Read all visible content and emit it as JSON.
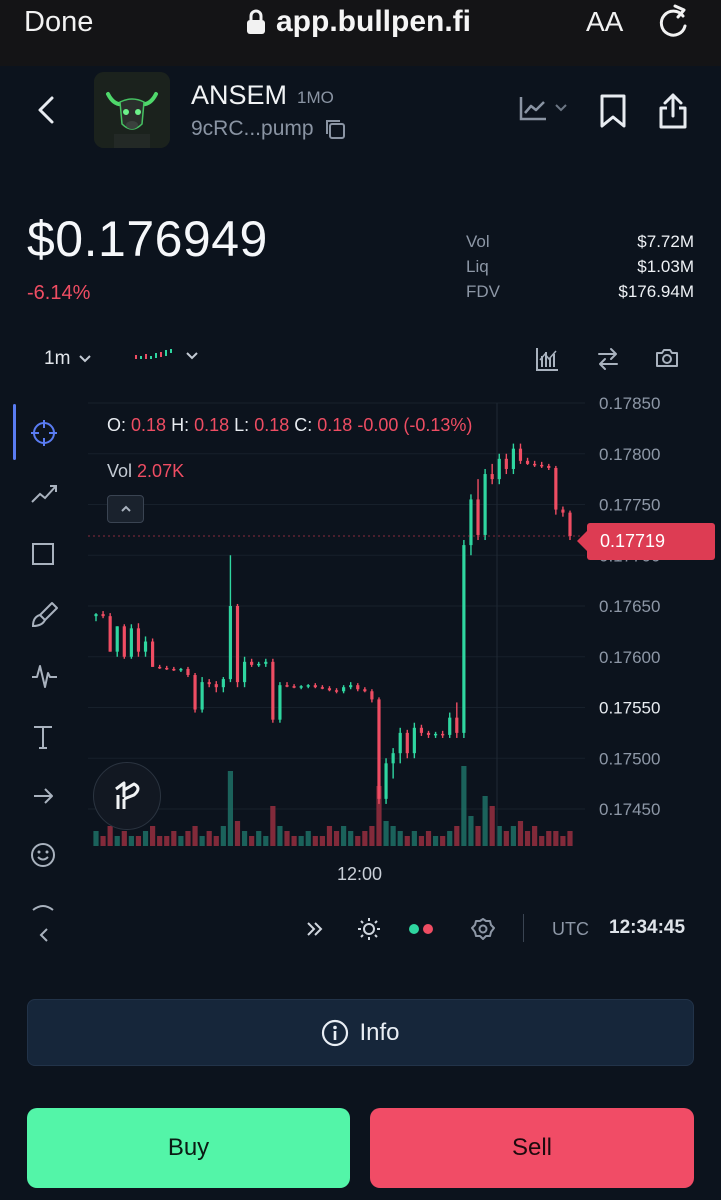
{
  "browser": {
    "done_label": "Done",
    "url": "app.bullpen.fi",
    "text_size_label": "AA",
    "icons": [
      "lock-icon",
      "reload-icon"
    ]
  },
  "token": {
    "name": "ANSEM",
    "age": "1MO",
    "address": "9cRC...pump",
    "price": "$0.176949",
    "change_24h": "-6.14%",
    "stats": [
      {
        "label": "Vol",
        "value": "$7.72M"
      },
      {
        "label": "Liq",
        "value": "$1.03M"
      },
      {
        "label": "FDV",
        "value": "$176.94M"
      }
    ]
  },
  "chart_toolbar": {
    "interval": "1m",
    "icons": [
      "candles-icon",
      "indicators-icon",
      "swap-icon",
      "camera-icon"
    ]
  },
  "drawing_tools": [
    "crosshair-icon",
    "trend-line-icon",
    "rectangle-icon",
    "brush-icon",
    "pattern-icon",
    "text-tool-icon",
    "arrow-icon",
    "emoji-icon"
  ],
  "legend": {
    "o_label": "O:",
    "o": "0.18",
    "h_label": "H:",
    "h": "0.18",
    "l_label": "L:",
    "l": "0.18",
    "c_label": "C:",
    "c": "0.18",
    "chg": "-0.00",
    "chg_pct": "(-0.13%)",
    "vol_label": "Vol",
    "vol": "2.07K"
  },
  "current_price_label": "0.17719",
  "bottom_toolbar": {
    "timezone": "UTC",
    "time": "12:34:45"
  },
  "info_button_label": "Info",
  "buy_label": "Buy",
  "sell_label": "Sell",
  "colors": {
    "up": "#2fd6a0",
    "down": "#ef4d63",
    "accent": "#5a7cf2",
    "buy": "#53f5a8",
    "sell": "#f14c66"
  },
  "chart_data": {
    "type": "candlestick",
    "title": "",
    "xlabel": "",
    "ylabel": "",
    "x_tick_labels": [
      "12:00"
    ],
    "y_ticks": [
      "0.17850",
      "0.17800",
      "0.17750",
      "0.17700",
      "0.17650",
      "0.17600",
      "0.17550",
      "0.17500",
      "0.17450"
    ],
    "ylim": [
      0.1743,
      0.1787
    ],
    "last_price": 0.17719,
    "series": [
      {
        "name": "",
        "candles": [
          [
            0.1764,
            0.17643,
            0.17635,
            0.17642
          ],
          [
            0.17642,
            0.17645,
            0.17638,
            0.1764
          ],
          [
            0.1764,
            0.17643,
            0.17605,
            0.17605
          ],
          [
            0.17605,
            0.1763,
            0.176,
            0.1763
          ],
          [
            0.1763,
            0.17632,
            0.17598,
            0.176
          ],
          [
            0.176,
            0.17632,
            0.17598,
            0.17628
          ],
          [
            0.17628,
            0.17633,
            0.176,
            0.17605
          ],
          [
            0.17605,
            0.1762,
            0.176,
            0.17615
          ],
          [
            0.17615,
            0.17618,
            0.1759,
            0.1759
          ],
          [
            0.1759,
            0.17592,
            0.17588,
            0.17589
          ],
          [
            0.17589,
            0.17591,
            0.17587,
            0.17588
          ],
          [
            0.17588,
            0.1759,
            0.17586,
            0.17587
          ],
          [
            0.17587,
            0.17589,
            0.17585,
            0.17588
          ],
          [
            0.17588,
            0.1759,
            0.1758,
            0.17582
          ],
          [
            0.17582,
            0.17584,
            0.17545,
            0.17548
          ],
          [
            0.17548,
            0.1758,
            0.17545,
            0.17575
          ],
          [
            0.17575,
            0.17578,
            0.1757,
            0.17573
          ],
          [
            0.17573,
            0.17576,
            0.17565,
            0.1757
          ],
          [
            0.1757,
            0.1758,
            0.17565,
            0.17578
          ],
          [
            0.17578,
            0.177,
            0.17575,
            0.1765
          ],
          [
            0.1765,
            0.17652,
            0.1757,
            0.17575
          ],
          [
            0.17575,
            0.176,
            0.1757,
            0.17595
          ],
          [
            0.17595,
            0.17598,
            0.1759,
            0.17592
          ],
          [
            0.17592,
            0.17595,
            0.1759,
            0.17593
          ],
          [
            0.17593,
            0.17598,
            0.1759,
            0.17595
          ],
          [
            0.17595,
            0.17598,
            0.17535,
            0.17538
          ],
          [
            0.17538,
            0.17575,
            0.17535,
            0.17572
          ],
          [
            0.17572,
            0.17575,
            0.1757,
            0.17571
          ],
          [
            0.17571,
            0.17573,
            0.17569,
            0.1757
          ],
          [
            0.1757,
            0.17572,
            0.17568,
            0.17571
          ],
          [
            0.17571,
            0.17573,
            0.17569,
            0.17572
          ],
          [
            0.17572,
            0.17574,
            0.17569,
            0.1757
          ],
          [
            0.1757,
            0.17572,
            0.17568,
            0.17569
          ],
          [
            0.17569,
            0.17571,
            0.17566,
            0.17567
          ],
          [
            0.17567,
            0.17569,
            0.17564,
            0.17566
          ],
          [
            0.17566,
            0.17572,
            0.17564,
            0.1757
          ],
          [
            0.1757,
            0.17575,
            0.17568,
            0.17572
          ],
          [
            0.17572,
            0.17574,
            0.17566,
            0.17568
          ],
          [
            0.17568,
            0.1757,
            0.17565,
            0.17566
          ],
          [
            0.17566,
            0.17568,
            0.17555,
            0.17558
          ],
          [
            0.17558,
            0.1756,
            0.17455,
            0.1746
          ],
          [
            0.1746,
            0.175,
            0.17455,
            0.17495
          ],
          [
            0.17495,
            0.1751,
            0.1748,
            0.17505
          ],
          [
            0.17505,
            0.1753,
            0.17495,
            0.17525
          ],
          [
            0.17525,
            0.17528,
            0.175,
            0.17505
          ],
          [
            0.17505,
            0.17535,
            0.175,
            0.1753
          ],
          [
            0.1753,
            0.17533,
            0.17522,
            0.17525
          ],
          [
            0.17525,
            0.17527,
            0.1752,
            0.17523
          ],
          [
            0.17523,
            0.17526,
            0.1752,
            0.17524
          ],
          [
            0.17524,
            0.17527,
            0.1752,
            0.17523
          ],
          [
            0.17523,
            0.17545,
            0.1752,
            0.1754
          ],
          [
            0.1754,
            0.17555,
            0.1752,
            0.17525
          ],
          [
            0.17525,
            0.17715,
            0.1752,
            0.1771
          ],
          [
            0.1771,
            0.1776,
            0.177,
            0.17755
          ],
          [
            0.17755,
            0.17775,
            0.17715,
            0.1772
          ],
          [
            0.1772,
            0.17785,
            0.17715,
            0.1778
          ],
          [
            0.1778,
            0.1779,
            0.1777,
            0.17775
          ],
          [
            0.17775,
            0.178,
            0.1777,
            0.17795
          ],
          [
            0.17795,
            0.178,
            0.1778,
            0.17785
          ],
          [
            0.17785,
            0.1781,
            0.1778,
            0.17805
          ],
          [
            0.17805,
            0.1781,
            0.1779,
            0.17793
          ],
          [
            0.17793,
            0.17796,
            0.17789,
            0.1779
          ],
          [
            0.1779,
            0.17793,
            0.17787,
            0.17789
          ],
          [
            0.17789,
            0.17792,
            0.17786,
            0.17788
          ],
          [
            0.17788,
            0.1779,
            0.17784,
            0.17786
          ],
          [
            0.17786,
            0.17788,
            0.1774,
            0.17745
          ],
          [
            0.17745,
            0.17748,
            0.17738,
            0.17742
          ],
          [
            0.17742,
            0.17744,
            0.17715,
            0.17719
          ]
        ],
        "volumes": [
          3,
          2,
          4,
          2,
          3,
          2,
          2,
          3,
          4,
          2,
          2,
          3,
          2,
          3,
          4,
          2,
          3,
          2,
          4,
          15,
          5,
          3,
          2,
          3,
          2,
          8,
          4,
          3,
          2,
          2,
          3,
          2,
          2,
          4,
          3,
          4,
          3,
          2,
          3,
          4,
          12,
          5,
          4,
          3,
          2,
          3,
          2,
          3,
          2,
          2,
          3,
          4,
          16,
          6,
          4,
          10,
          8,
          4,
          3,
          4,
          5,
          3,
          4,
          2,
          3,
          3,
          2,
          3
        ]
      }
    ]
  }
}
